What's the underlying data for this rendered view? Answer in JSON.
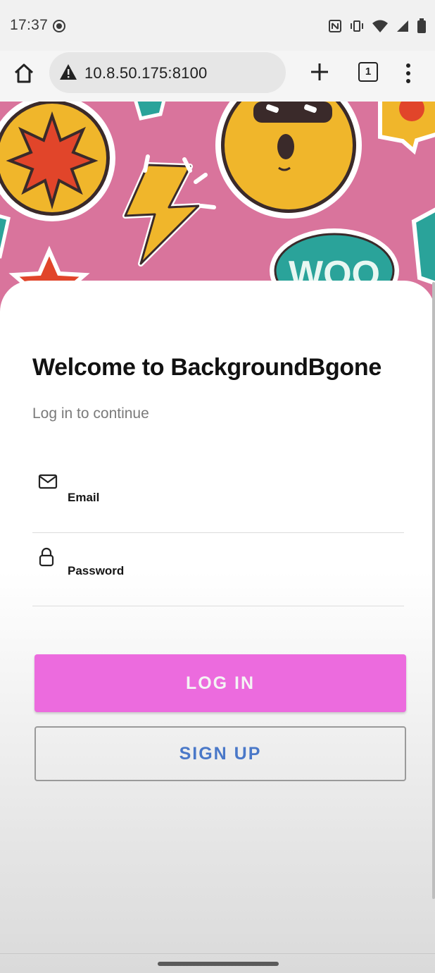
{
  "status_bar": {
    "time": "17:37",
    "icons": [
      "screen-record-icon",
      "nfc-icon",
      "vibrate-icon",
      "wifi-icon",
      "signal-icon",
      "battery-icon"
    ]
  },
  "browser": {
    "url": "10.8.50.175:8100",
    "tab_count": "1",
    "icons": [
      "home-icon",
      "warning-icon",
      "plus-icon",
      "tabs-icon",
      "menu-icon"
    ]
  },
  "hero": {
    "sticker_text": "WOO"
  },
  "login": {
    "title": "Welcome to BackgroundBgone",
    "subtitle": "Log in to continue",
    "email_label": "Email",
    "password_label": "Password",
    "login_button": "LOG IN",
    "signup_button": "SIGN UP"
  },
  "colors": {
    "hero_background": "#d9749c",
    "login_button": "#ec6bde",
    "signup_text": "#4a78c8"
  }
}
